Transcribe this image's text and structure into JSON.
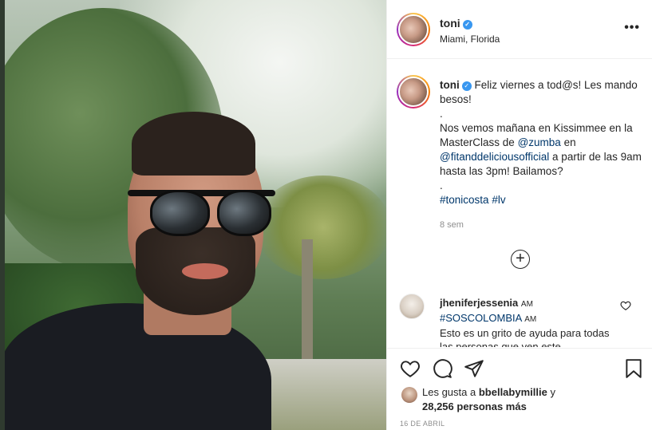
{
  "post": {
    "username": "toni",
    "location": "Miami, Florida",
    "more_label": "•••"
  },
  "caption": {
    "username": "toni",
    "line1": "Feliz viernes a tod@s! Les mando besos!",
    "dot1": ".",
    "line2_pre": "Nos vemos mañana en Kissimmee en la MasterClass de",
    "mention1": "@zumba",
    "line2_mid": "en",
    "mention2": "@fitanddeliciousofficial",
    "line2_post": "a partir de las 9am hasta las 3pm! Bailamos?",
    "dot2": ".",
    "hashtag1": "#tonicosta",
    "hashtag2": "#lv",
    "time": "8 sem"
  },
  "load_more": {
    "label": "+"
  },
  "comment": {
    "username": "jheniferjessenia",
    "time1": "AM",
    "hashtag": "#SOSCOLOMBIA",
    "time2": "AM",
    "text": "Esto es un grito de ayuda para todas las personas que ven este"
  },
  "likes": {
    "prefix": "Les gusta a",
    "user": "bbellabymillie",
    "conj": "y",
    "count": "28,256 personas más"
  },
  "date": "16 DE ABRIL",
  "colors": {
    "verified": "#3897f0",
    "link": "#00376b",
    "text": "#262626",
    "muted": "#8e8e8e"
  },
  "icons": [
    "heart-icon",
    "comment-icon",
    "share-icon",
    "save-icon",
    "verified-icon",
    "add-circle-icon",
    "more-icon"
  ]
}
